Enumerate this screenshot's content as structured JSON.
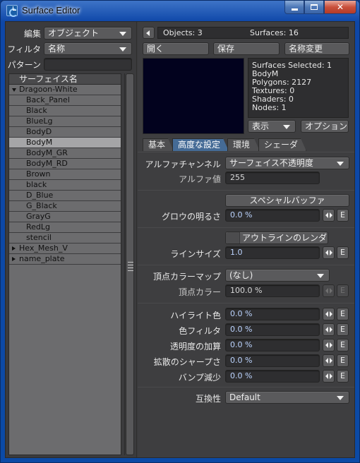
{
  "window": {
    "title": "Surface Editor"
  },
  "left_panel": {
    "edit_label": "編集",
    "edit_value": "オブジェクト",
    "filter_label": "フィルタ",
    "filter_value": "名称",
    "pattern_label": "パターン",
    "pattern_value": "",
    "list_header": "サーフェイス名",
    "groups": [
      {
        "name": "Dragoon-White",
        "expanded": true,
        "surfaces": [
          "Back_Panel",
          "Black",
          "BlueLg",
          "BodyD",
          "BodyM",
          "BodyM_GR",
          "BodyM_RD",
          "Brown",
          "black",
          "D_Blue",
          "G_Black",
          "GrayG",
          "RedLg",
          "stencil"
        ]
      },
      {
        "name": "Hex_Mesh_V",
        "expanded": false,
        "surfaces": []
      },
      {
        "name": "name_plate",
        "expanded": false,
        "surfaces": []
      }
    ],
    "selected_surface": "BodyM"
  },
  "top_bar": {
    "objects": "Objects: 3",
    "surfaces": "Surfaces: 16",
    "open_label": "開く",
    "save_label": "保存",
    "rename_label": "名称変更"
  },
  "info_panel": {
    "lines": [
      "Surfaces Selected: 1",
      "BodyM",
      "Polygons: 2127",
      "Textures: 0",
      "Shaders: 0",
      "Nodes: 1"
    ],
    "display_label": "表示",
    "options_label": "オプション"
  },
  "tabs": [
    {
      "label": "基本",
      "active": false
    },
    {
      "label": "高度な設定",
      "active": true
    },
    {
      "label": "環境",
      "active": false
    },
    {
      "label": "シェーダ",
      "active": false
    }
  ],
  "advanced": {
    "alpha_channel_label": "アルファチャンネル",
    "alpha_channel_value": "サーフェイス不透明度",
    "alpha_value_label": "アルファ値",
    "alpha_value": "255",
    "special_buffer_label": "スペシャルバッファ",
    "glow_label": "グロウの明るさ",
    "glow_value": "0.0 %",
    "render_outline_label": "アウトラインのレンダー",
    "line_size_label": "ラインサイズ",
    "line_size_value": "1.0",
    "vertex_color_map_label": "頂点カラーマップ",
    "vertex_color_map_value": "(なし)",
    "vertex_color_label": "頂点カラー",
    "vertex_color_value": "100.0 %",
    "highlight_color_label": "ハイライト色",
    "highlight_color_value": "0.0 %",
    "color_filter_label": "色フィルタ",
    "color_filter_value": "0.0 %",
    "additive_transparency_label": "透明度の加算",
    "additive_transparency_value": "0.0 %",
    "diffuse_sharpness_label": "拡散のシャープさ",
    "diffuse_sharpness_value": "0.0 %",
    "bump_drop_off_label": "バンプ減少",
    "bump_drop_off_value": "0.0 %",
    "compatibility_label": "互換性",
    "compatibility_value": "Default",
    "envelope_label": "E"
  }
}
